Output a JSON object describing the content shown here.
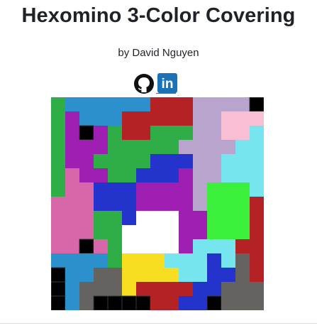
{
  "page": {
    "title": "Hexomino 3-Color Covering",
    "author": "by David Nguyen",
    "links": [
      {
        "icon": "github-icon"
      },
      {
        "icon": "linkedin-icon",
        "text": "in"
      }
    ]
  },
  "board": {
    "cols": 15,
    "rows": 15,
    "palette": {
      "B": "#000000",
      "W": "#ffffff",
      "G": "#2fae48",
      "P": "#a01fb3",
      "S": "#2c90cc",
      "R": "#b52226",
      "L": "#b9a4cd",
      "K": "#f8bed3",
      "C": "#76e5f0",
      "N": "#2333cc",
      "M": "#d767a8",
      "Y": "#f7de20",
      "D": "#64635f",
      "T": "#3bef3b"
    },
    "grid": [
      "GSSSSSSRRRLLLLB",
      "GPSSSRRRRRLLKKK",
      "GPBPGRRGGGLLKKC",
      "GPPPGGGGGLLLLCC",
      "GPPGGGGNNNLLCCC",
      "GMPPGGNNNPLLCCC",
      "GMMNNNPPPPLTTTC",
      "MMMNNNPPPPLTTTR",
      "MMMGGNWWWPPTTTR",
      "MMMGGWWWWPPTTTR",
      "MMBMGWWWWPCCCRR",
      "SSSSGYYYCCCNCDR",
      "BSSDDYYYYCCNNDR",
      "BSDDDYRRRRNNDDD",
      "BSDBBBBRRNNBDDD"
    ]
  }
}
